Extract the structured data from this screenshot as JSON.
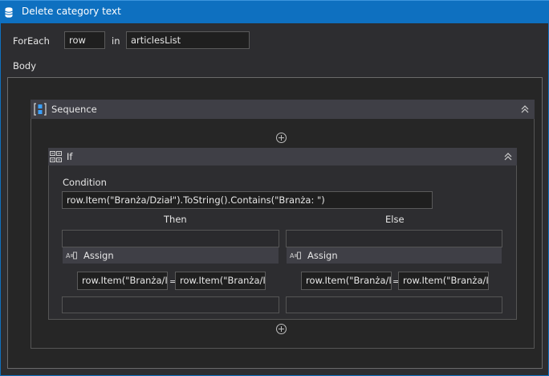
{
  "header": {
    "title": "Delete category text"
  },
  "foreach": {
    "keyword": "ForEach",
    "item_var": "row",
    "in_keyword": "in",
    "collection": "articlesList"
  },
  "body_label": "Body",
  "sequence": {
    "title": "Sequence"
  },
  "if_activity": {
    "title": "If",
    "condition_label": "Condition",
    "condition_value": "row.Item(\"Branża/Dział\").ToString().Contains(\"Branża: \")",
    "then_label": "Then",
    "else_label": "Else"
  },
  "then_assign": {
    "title": "Assign",
    "to": "row.Item(\"Branża/I",
    "equals": "=",
    "value": "row.Item(\"Branża/I"
  },
  "else_assign": {
    "title": "Assign",
    "to": "row.Item(\"Branża/I",
    "equals": "=",
    "value": "row.Item(\"Branża/I"
  },
  "colors": {
    "header_bg": "#0e70c0",
    "panel_bg": "#2d2d30",
    "activity_header_bg": "#3f3f46",
    "field_bg": "#1f1f1f"
  },
  "icons": {
    "header": "database-icon",
    "sequence": "sequence-icon",
    "if": "if-icon",
    "assign": "assign-icon",
    "collapse": "double-chevron-up-icon",
    "add": "add-activity-plus-icon"
  }
}
